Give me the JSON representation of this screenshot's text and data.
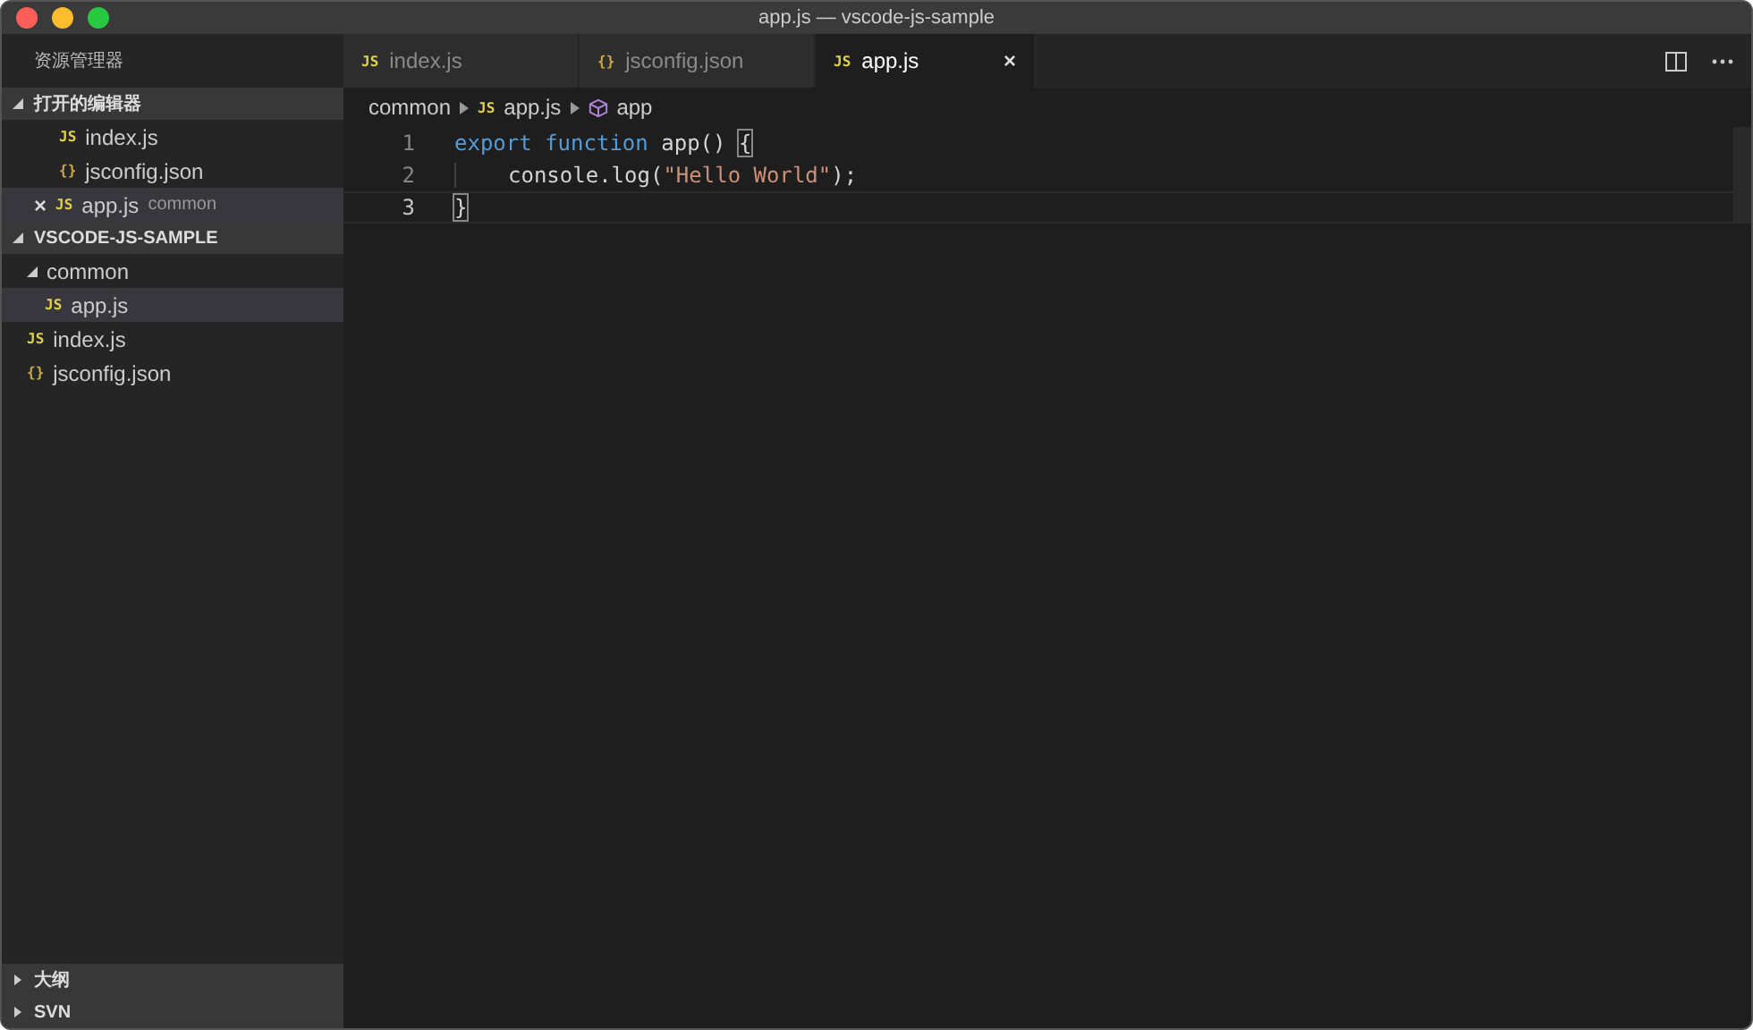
{
  "window": {
    "title": "app.js — vscode-js-sample"
  },
  "sidebar": {
    "title": "资源管理器",
    "sections": [
      {
        "title": "打开的编辑器",
        "expanded": true,
        "kind": "open",
        "items": [
          {
            "kind": "js",
            "icon_text": "JS",
            "name": "index.js",
            "selected": false
          },
          {
            "kind": "json",
            "icon_text": "{}",
            "name": "jsconfig.json",
            "selected": false
          },
          {
            "kind": "js",
            "icon_text": "JS",
            "name": "app.js",
            "detail": "common",
            "close": "×",
            "selected": true
          }
        ]
      },
      {
        "title": "VSCODE-JS-SAMPLE",
        "expanded": true,
        "kind": "tree",
        "items": [
          {
            "kind": "folder",
            "name": "common",
            "expanded": true,
            "selected": false,
            "children": [
              {
                "kind": "js",
                "icon_text": "JS",
                "name": "app.js",
                "selected": true
              }
            ]
          },
          {
            "kind": "js",
            "icon_text": "JS",
            "name": "index.js",
            "selected": false
          },
          {
            "kind": "json",
            "icon_text": "{}",
            "name": "jsconfig.json",
            "selected": false
          }
        ]
      }
    ],
    "bottom_sections": [
      {
        "title": "大纲",
        "expanded": false
      },
      {
        "title": "SVN",
        "expanded": false
      }
    ]
  },
  "tabs": [
    {
      "kind": "js",
      "icon_text": "JS",
      "label": "index.js",
      "selected": false
    },
    {
      "kind": "json",
      "icon_text": "{}",
      "label": "jsconfig.json",
      "selected": false
    },
    {
      "kind": "js",
      "icon_text": "JS",
      "label": "app.js",
      "selected": true,
      "close": "×"
    }
  ],
  "breadcrumbs": [
    {
      "kind": "folder",
      "label": "common"
    },
    {
      "kind": "js",
      "icon_text": "JS",
      "label": "app.js"
    },
    {
      "kind": "symbol",
      "label": "app"
    }
  ],
  "editor": {
    "lines": [
      {
        "number": "1",
        "current": false,
        "indented": false,
        "tokens": [
          {
            "kind": "keyword",
            "text": "export"
          },
          {
            "kind": "keyword",
            "text": " function"
          },
          {
            "kind": "plain",
            "text": " app() "
          },
          {
            "kind": "bracket",
            "text": "{",
            "matched": true
          }
        ]
      },
      {
        "number": "2",
        "current": false,
        "indented": true,
        "tokens": [
          {
            "kind": "plain",
            "text": "console.log("
          },
          {
            "kind": "string",
            "text": "\"Hello World\""
          },
          {
            "kind": "plain",
            "text": ");"
          }
        ]
      },
      {
        "number": "3",
        "current": true,
        "indented": false,
        "tokens": [
          {
            "kind": "bracket",
            "text": "}",
            "matched": true
          }
        ]
      }
    ]
  }
}
